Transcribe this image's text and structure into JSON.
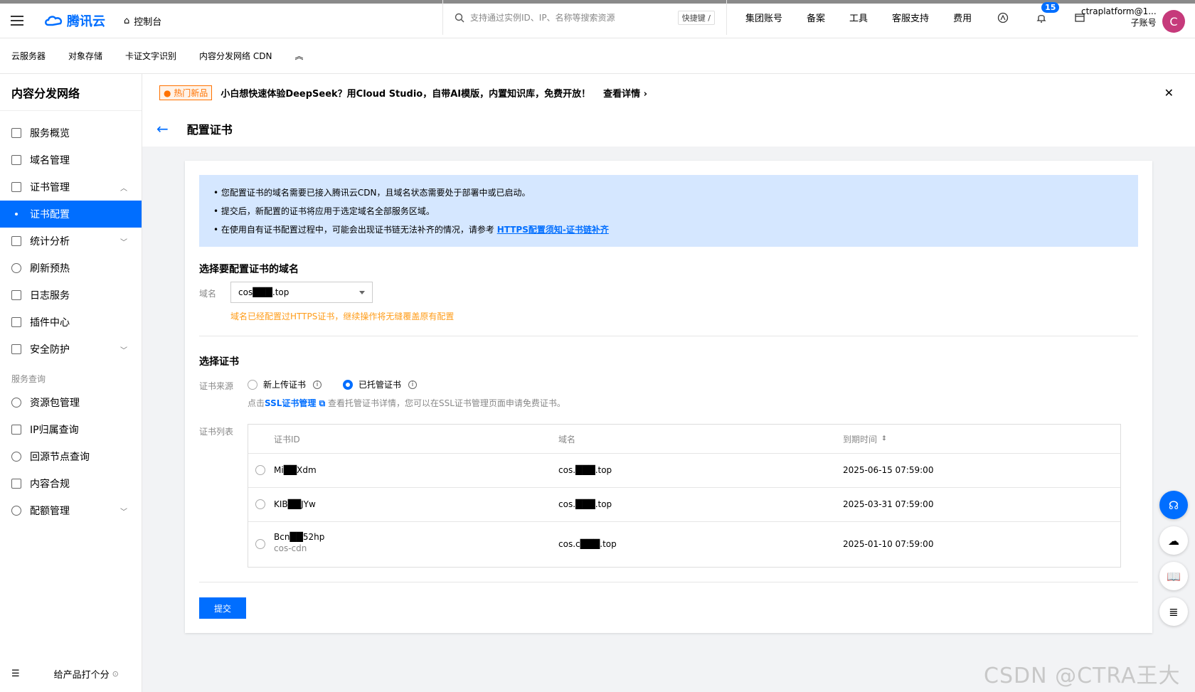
{
  "topbar": {
    "logo_text": "腾讯云",
    "console_label": "控制台",
    "search_placeholder": "支持通过实例ID、IP、名称等搜索资源",
    "search_shortcut": "快捷键 /",
    "nav_items": [
      "集团账号",
      "备案",
      "工具",
      "客服支持",
      "费用"
    ],
    "notifications_count": "15",
    "account_name": "ctraplatform@1...",
    "account_type": "子账号",
    "avatar_letter": "C"
  },
  "subbar": {
    "items": [
      "云服务器",
      "对象存储",
      "卡证文字识别",
      "内容分发网络 CDN"
    ]
  },
  "sidebar": {
    "title": "内容分发网络",
    "items": [
      {
        "label": "服务概览"
      },
      {
        "label": "域名管理"
      },
      {
        "label": "证书管理"
      },
      {
        "label": "证书配置"
      },
      {
        "label": "统计分析"
      },
      {
        "label": "刷新预热"
      },
      {
        "label": "日志服务"
      },
      {
        "label": "插件中心"
      },
      {
        "label": "安全防护"
      }
    ],
    "group_label": "服务查询",
    "group_items": [
      {
        "label": "资源包管理"
      },
      {
        "label": "IP归属查询"
      },
      {
        "label": "回源节点查询"
      },
      {
        "label": "内容合规"
      },
      {
        "label": "配额管理"
      }
    ],
    "rate_label": "给产品打个分"
  },
  "banner": {
    "tag": "热门新品",
    "text": "小白想快速体验DeepSeek？用Cloud Studio，自带AI模版，内置知识库，免费开放！",
    "more": "查看详情"
  },
  "page": {
    "title": "配置证书"
  },
  "notice": {
    "line1": "您配置证书的域名需要已接入腾讯云CDN，且域名状态需要处于部署中或已启动。",
    "line2": "提交后，新配置的证书将应用于选定域名全部服务区域。",
    "line3": "在使用自有证书配置过程中，可能会出现证书链无法补齐的情况，请参考 ",
    "line3_link": "HTTPS配置须知-证书链补齐"
  },
  "domain_section": {
    "title": "选择要配置证书的域名",
    "label": "域名",
    "value": "cos███.top",
    "warning": "域名已经配置过HTTPS证书，继续操作将无缝覆盖原有配置"
  },
  "cert_section": {
    "title": "选择证书",
    "source_label": "证书来源",
    "option_new": "新上传证书",
    "option_managed": "已托管证书",
    "hint_prefix": "点击",
    "hint_link": "SSL证书管理",
    "hint_suffix": " 查看托管证书详情，您可以在SSL证书管理页面申请免费证书。",
    "list_label": "证书列表",
    "columns": [
      "证书ID",
      "域名",
      "到期时间"
    ],
    "rows": [
      {
        "id": "Mi██Xdm",
        "sub": "",
        "domain": "cos.███.top",
        "expire": "2025-06-15 07:59:00"
      },
      {
        "id": "KIB██JYw",
        "sub": "",
        "domain": "cos.███.top",
        "expire": "2025-03-31 07:59:00"
      },
      {
        "id": "Bcn██52hp",
        "sub": "cos-cdn",
        "domain": "cos.c███.top",
        "expire": "2025-01-10 07:59:00"
      }
    ],
    "submit": "提交"
  },
  "watermark": "CSDN @CTRA王大大"
}
